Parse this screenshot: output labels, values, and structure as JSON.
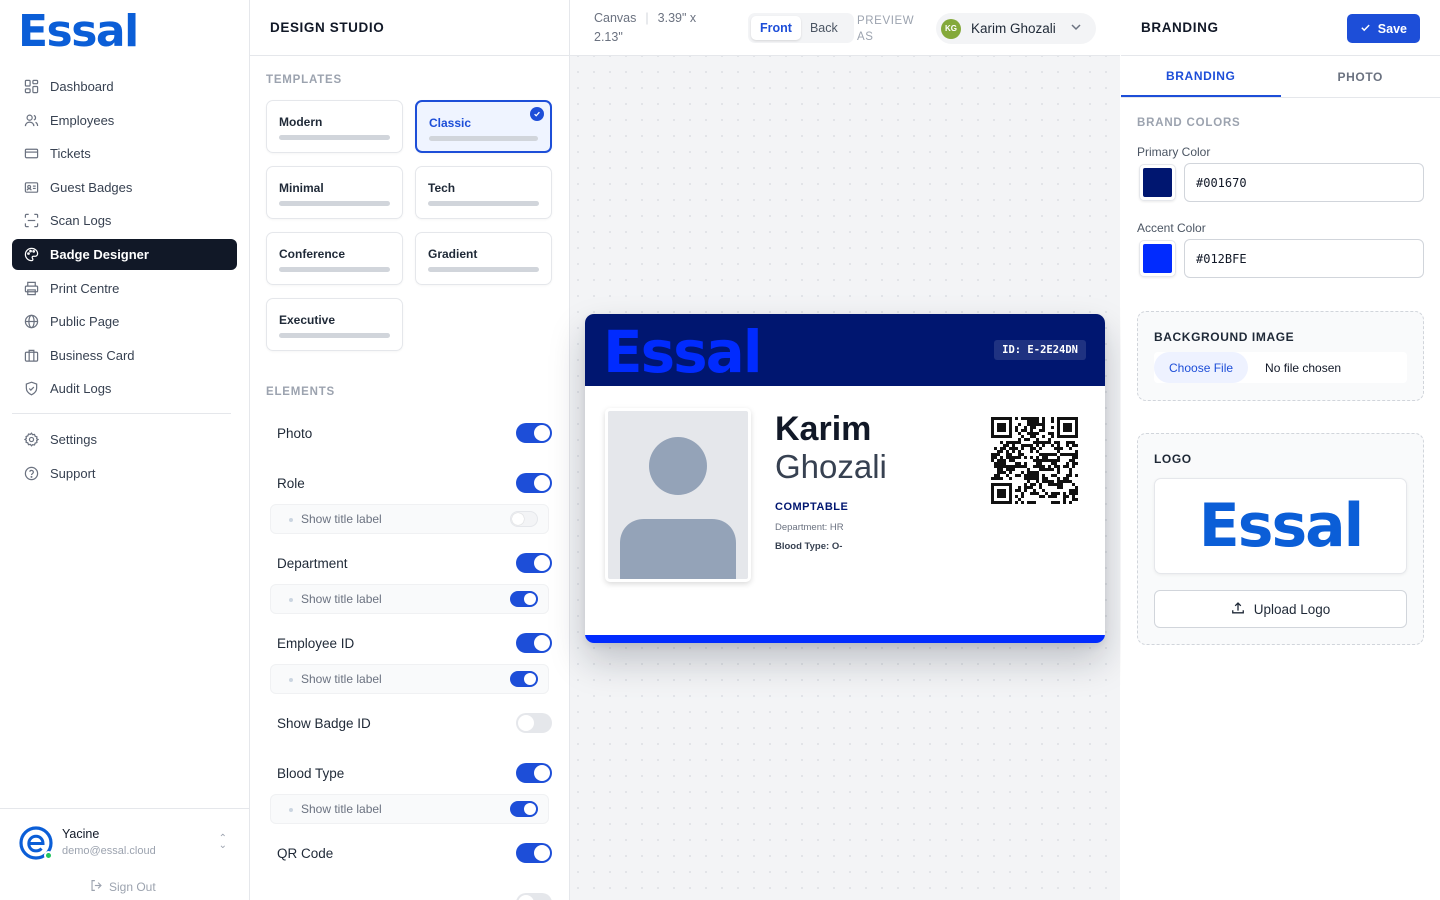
{
  "app": {
    "logo_text": "Essal"
  },
  "sidebar": {
    "items": [
      {
        "label": "Dashboard",
        "icon": "dashboard-icon"
      },
      {
        "label": "Employees",
        "icon": "users-icon"
      },
      {
        "label": "Tickets",
        "icon": "ticket-icon"
      },
      {
        "label": "Guest Badges",
        "icon": "id-card-icon"
      },
      {
        "label": "Scan Logs",
        "icon": "scan-icon"
      },
      {
        "label": "Badge Designer",
        "icon": "palette-icon",
        "active": true
      },
      {
        "label": "Print Centre",
        "icon": "printer-icon"
      },
      {
        "label": "Public Page",
        "icon": "globe-icon"
      },
      {
        "label": "Business Card",
        "icon": "briefcase-icon"
      },
      {
        "label": "Audit Logs",
        "icon": "shield-icon"
      }
    ],
    "secondary": [
      {
        "label": "Settings",
        "icon": "gear-icon"
      },
      {
        "label": "Support",
        "icon": "help-icon"
      }
    ],
    "user": {
      "name": "Yacine",
      "email": "demo@essal.cloud"
    },
    "sign_out_label": "Sign Out"
  },
  "studio": {
    "title": "DESIGN STUDIO",
    "templates_label": "TEMPLATES",
    "templates": [
      {
        "name": "Modern",
        "selected": false
      },
      {
        "name": "Classic",
        "selected": true
      },
      {
        "name": "Minimal",
        "selected": false
      },
      {
        "name": "Tech",
        "selected": false
      },
      {
        "name": "Conference",
        "selected": false
      },
      {
        "name": "Gradient",
        "selected": false
      },
      {
        "name": "Executive",
        "selected": false
      }
    ],
    "elements_label": "ELEMENTS",
    "elements": {
      "photo": {
        "label": "Photo",
        "on": true
      },
      "role": {
        "label": "Role",
        "on": true,
        "sub_label": "Show title label",
        "sub_on": false
      },
      "department": {
        "label": "Department",
        "on": true,
        "sub_label": "Show title label",
        "sub_on": true
      },
      "employee_id": {
        "label": "Employee ID",
        "on": true,
        "sub_label": "Show title label",
        "sub_on": true
      },
      "badge_id": {
        "label": "Show Badge ID",
        "on": false
      },
      "blood_type": {
        "label": "Blood Type",
        "on": true,
        "sub_label": "Show title label",
        "sub_on": true
      },
      "qr_code": {
        "label": "QR Code",
        "on": true
      }
    }
  },
  "canvas": {
    "label": "Canvas",
    "size": "3.39\" x 2.13\"",
    "side_options": [
      "Front",
      "Back"
    ],
    "active_side": "Front",
    "preview_as_label": "PREVIEW AS",
    "preview_user": {
      "initials": "KG",
      "name": "Karim Ghozali"
    }
  },
  "badge": {
    "logo_text": "Essal",
    "id_text": "ID: E-2E24DN",
    "first_name": "Karim",
    "last_name": "Ghozali",
    "role": "COMPTABLE",
    "department": "Department: HR",
    "blood_type_label": "Blood Type:",
    "blood_type_value": "O-"
  },
  "branding": {
    "title": "BRANDING",
    "save_label": "Save",
    "tabs": [
      "BRANDING",
      "PHOTO"
    ],
    "active_tab": "BRANDING",
    "brand_colors_label": "BRAND COLORS",
    "primary_label": "Primary Color",
    "primary_color": "#001670",
    "accent_label": "Accent Color",
    "accent_color": "#012BFE",
    "bg_image_label": "BACKGROUND IMAGE",
    "choose_file_label": "Choose File",
    "no_file_label": "No file chosen",
    "logo_label": "LOGO",
    "logo_preview_text": "Essal",
    "upload_logo_label": "Upload Logo"
  }
}
